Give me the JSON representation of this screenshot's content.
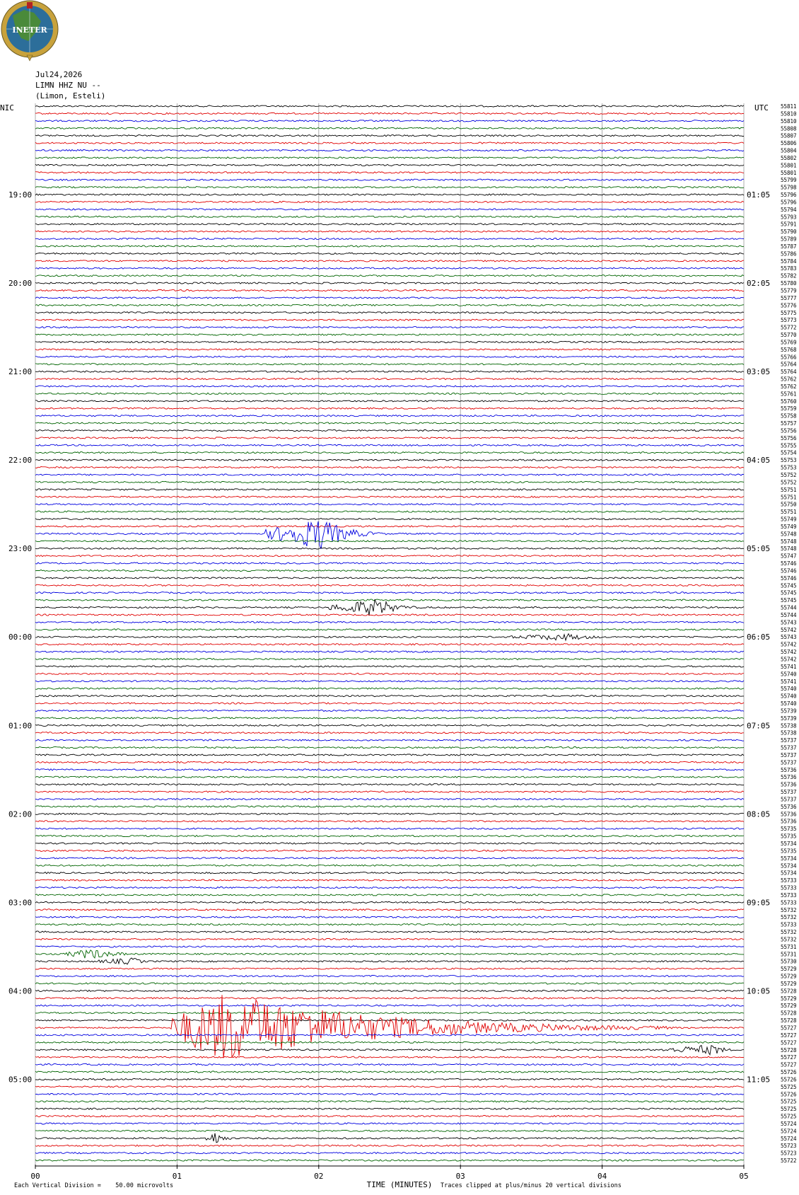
{
  "logo": {
    "text": "INETER",
    "colors": {
      "ring": "#c8a23c",
      "disc": "#2c6e9a",
      "land": "#4a8a3a",
      "flag": "#b22222"
    }
  },
  "header": {
    "date": "Jul24,2026",
    "station": "LIMN HHZ NU --",
    "location": "(Limon, Esteli)"
  },
  "left_tz": "NIC",
  "right_tz": "UTC",
  "footer": {
    "vertical_division": "Each Vertical Division =    50.00 microvolts",
    "clip_note": "Traces clipped at plus/minus 20 vertical divisions"
  },
  "chart_data": {
    "type": "line",
    "title": "",
    "xlabel": "TIME (MINUTES)",
    "x_ticks": [
      "00",
      "01",
      "02",
      "03",
      "04",
      "05"
    ],
    "xlim": [
      0,
      5
    ],
    "trace_colors": [
      "#000000",
      "#e00000",
      "#0000e0",
      "#006400"
    ],
    "trace_count": 144,
    "left_hour_labels": [
      "19:00",
      "20:00",
      "21:00",
      "22:00",
      "23:00",
      "00:00",
      "01:00",
      "02:00",
      "03:00",
      "04:00",
      "05:00"
    ],
    "right_hour_labels": [
      "01:05",
      "02:05",
      "03:05",
      "04:05",
      "05:05",
      "06:05",
      "07:05",
      "08:05",
      "09:05",
      "10:05",
      "11:05"
    ],
    "hour_label_rows": [
      12,
      24,
      36,
      48,
      60,
      72,
      84,
      96,
      108,
      120,
      132
    ],
    "offset_labels": [
      "55811",
      "55810",
      "55810",
      "55808",
      "55807",
      "55806",
      "55804",
      "55802",
      "55801",
      "55801",
      "55799",
      "55798",
      "55796",
      "55796",
      "55794",
      "55793",
      "55791",
      "55790",
      "55789",
      "55787",
      "55786",
      "55784",
      "55783",
      "55782",
      "55780",
      "55779",
      "55777",
      "55776",
      "55775",
      "55773",
      "55772",
      "55770",
      "55769",
      "55768",
      "55766",
      "55764",
      "55764",
      "55762",
      "55762",
      "55761",
      "55760",
      "55759",
      "55758",
      "55757",
      "55756",
      "55756",
      "55755",
      "55754",
      "55753",
      "55753",
      "55752",
      "55752",
      "55751",
      "55751",
      "55750",
      "55751",
      "55749",
      "55749",
      "55748",
      "55748",
      "55748",
      "55747",
      "55746",
      "55746",
      "55746",
      "55745",
      "55745",
      "55745",
      "55744",
      "55744",
      "55743",
      "55742",
      "55743",
      "55742",
      "55742",
      "55742",
      "55741",
      "55740",
      "55741",
      "55740",
      "55740",
      "55740",
      "55739",
      "55739",
      "55738",
      "55738",
      "55737",
      "55737",
      "55737",
      "55737",
      "55736",
      "55736",
      "55736",
      "55737",
      "55737",
      "55736",
      "55736",
      "55736",
      "55735",
      "55735",
      "55734",
      "55735",
      "55734",
      "55734",
      "55734",
      "55733",
      "55733",
      "55733",
      "55733",
      "55732",
      "55732",
      "55733",
      "55732",
      "55732",
      "55731",
      "55731",
      "55730",
      "55729",
      "55729",
      "55729",
      "55728",
      "55729",
      "55729",
      "55728",
      "55728",
      "55727",
      "55727",
      "55727",
      "55728",
      "55727",
      "55727",
      "55726",
      "55726",
      "55725",
      "55726",
      "55725",
      "55725",
      "55725",
      "55724",
      "55724",
      "55724",
      "55723",
      "55723",
      "55722",
      "55722",
      "55722"
    ],
    "events": [
      {
        "row": 58,
        "start_min": 1.62,
        "peak_min": 2.02,
        "end_min": 2.55,
        "amplitude_div": 9
      },
      {
        "row": 68,
        "start_min": 2.07,
        "peak_min": 2.42,
        "end_min": 2.82,
        "amplitude_div": 5
      },
      {
        "row": 72,
        "start_min": 3.3,
        "peak_min": 3.75,
        "end_min": 4.4,
        "amplitude_div": 2
      },
      {
        "row": 115,
        "start_min": 0.2,
        "peak_min": 0.4,
        "end_min": 0.9,
        "amplitude_div": 3
      },
      {
        "row": 116,
        "start_min": 0.4,
        "peak_min": 0.7,
        "end_min": 0.9,
        "amplitude_div": 2
      },
      {
        "row": 125,
        "start_min": 0.95,
        "peak_min": 1.35,
        "end_min": 4.5,
        "amplitude_div": 20
      },
      {
        "row": 128,
        "start_min": 4.4,
        "peak_min": 4.8,
        "end_min": 5.0,
        "amplitude_div": 3
      },
      {
        "row": 140,
        "start_min": 1.2,
        "peak_min": 1.28,
        "end_min": 1.45,
        "amplitude_div": 4
      }
    ]
  }
}
